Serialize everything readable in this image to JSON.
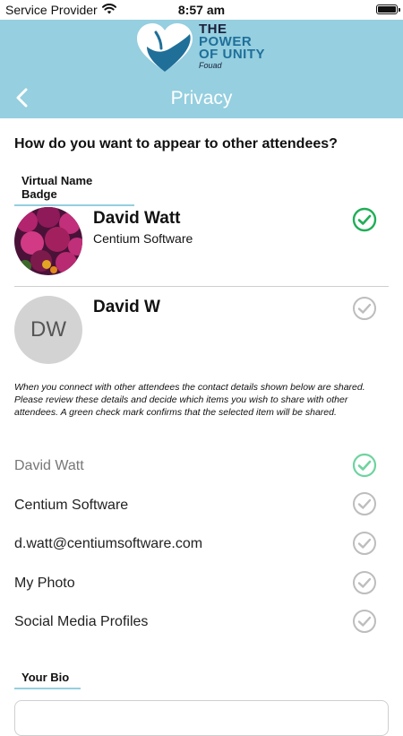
{
  "status_bar": {
    "carrier": "Service Provider",
    "time": "8:57 am"
  },
  "header": {
    "title": "Privacy",
    "logo": {
      "line1": "THE",
      "line2": "POWER",
      "line3": "OF UNITY",
      "signature": "Fouad"
    },
    "background_color": "#95cfe0"
  },
  "question": "How do you want to appear to other attendees?",
  "badge_section": {
    "label": "Virtual Name Badge",
    "options": [
      {
        "name": "David Watt",
        "company": "Centium Software",
        "selected": true,
        "avatar": "photo"
      },
      {
        "name": "David W",
        "initials": "DW",
        "selected": false,
        "avatar": "initials"
      }
    ]
  },
  "info_text": "When you connect with other attendees the contact details shown below are shared. Please review these details and decide which items you wish to share with other attendees. A green check mark confirms that the selected item will be shared.",
  "share_items": [
    {
      "label": "David Watt",
      "selected": true
    },
    {
      "label": "Centium Software",
      "selected": false
    },
    {
      "label": "d.watt@centiumsoftware.com",
      "selected": false
    },
    {
      "label": "My Photo",
      "selected": false
    },
    {
      "label": "Social Media Profiles",
      "selected": false
    }
  ],
  "bio_section": {
    "label": "Your Bio"
  },
  "colors": {
    "accent": "#95cfe0",
    "check_green": "#1fae57",
    "check_light_green": "#6fd3a0",
    "check_gray": "#bdbdbd"
  }
}
